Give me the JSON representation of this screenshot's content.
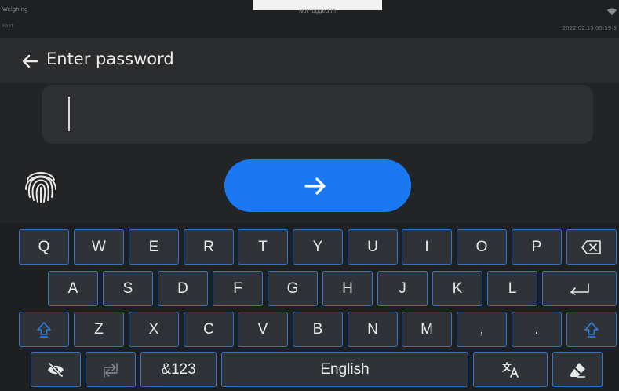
{
  "status_bar": {
    "mode": "Weighing",
    "sub_mode": "Fast",
    "login_status": "Not logged in",
    "datetime": "2022.02.15 05:59:3"
  },
  "header": {
    "back_icon": "arrow-left-icon",
    "title": "Enter password"
  },
  "password_field": {
    "value": ""
  },
  "fingerprint_icon": "fingerprint-icon",
  "submit_icon": "arrow-right-icon",
  "keyboard": {
    "row1": [
      "Q",
      "W",
      "E",
      "R",
      "T",
      "Y",
      "U",
      "I",
      "O",
      "P"
    ],
    "row2": [
      "A",
      "S",
      "D",
      "F",
      "G",
      "H",
      "J",
      "K",
      "L"
    ],
    "row3": [
      "Z",
      "X",
      "C",
      "V",
      "B",
      "N",
      "M",
      ",",
      "."
    ],
    "symbols_label": "&123",
    "space_label": "English",
    "backspace_icon": "backspace-icon",
    "enter_icon": "enter-icon",
    "shift_icon": "shift-icon",
    "hide_password_icon": "eye-off-icon",
    "switch_keyboard_icon": "swap-icon",
    "language_icon": "translate-icon",
    "clear_icon": "eraser-icon"
  },
  "colors": {
    "accent": "#1a78f2",
    "key_border": "#2e74c9",
    "background": "#222426"
  }
}
